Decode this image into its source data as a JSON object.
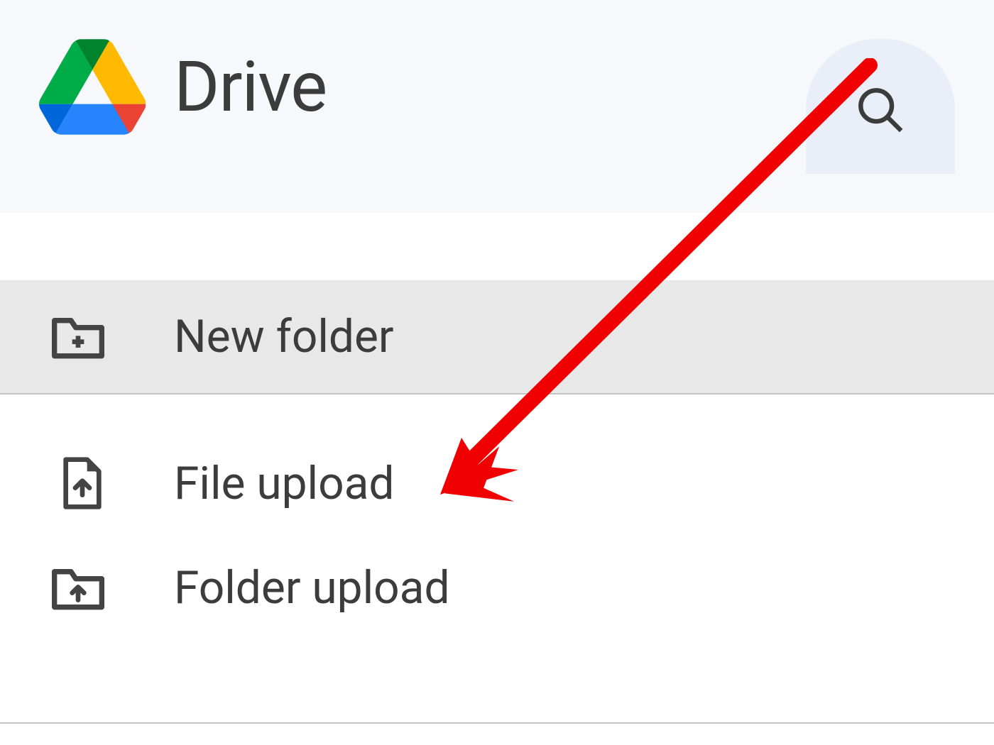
{
  "header": {
    "app_title": "Drive"
  },
  "menu": {
    "new_folder_label": "New folder",
    "file_upload_label": "File upload",
    "folder_upload_label": "Folder upload"
  },
  "annotation": {
    "arrow_color": "#f00000"
  }
}
